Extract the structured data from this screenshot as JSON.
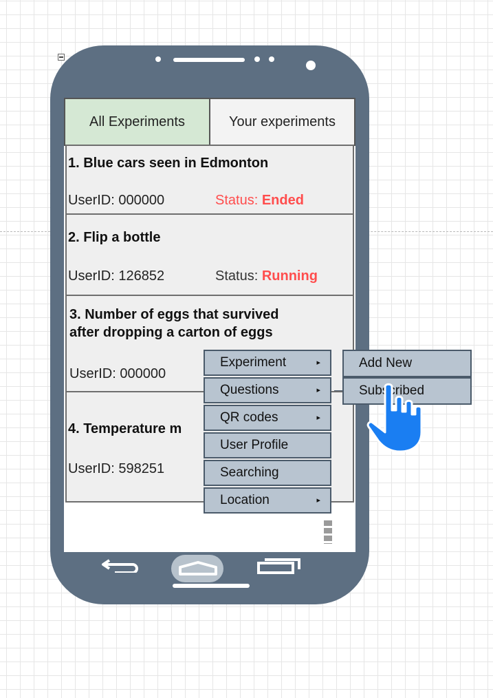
{
  "tabs": {
    "all_experiments": "All Experiments",
    "your_experiments": "Your experiments"
  },
  "experiments": [
    {
      "title": "1. Blue cars seen in Edmonton",
      "user_id": "UserID: 000000",
      "status_label": "Status:",
      "status_value": "Ended"
    },
    {
      "title": "2. Flip a bottle",
      "user_id": "UserID: 126852",
      "status_label": "Status:",
      "status_value": "Running"
    },
    {
      "title_line1": "3. Number of eggs that survived",
      "title_line2": "after dropping a carton of eggs",
      "user_id": "UserID: 000000"
    },
    {
      "title": "4. Temperature m",
      "user_id": "UserID: 598251"
    }
  ],
  "menu": {
    "items": [
      {
        "label": "Experiment",
        "has_submenu": true
      },
      {
        "label": "Questions",
        "has_submenu": true
      },
      {
        "label": "QR codes",
        "has_submenu": true
      },
      {
        "label": "User Profile",
        "has_submenu": false
      },
      {
        "label": "Searching",
        "has_submenu": false
      },
      {
        "label": "Location",
        "has_submenu": true
      }
    ],
    "submenu_arrow": "▸"
  },
  "submenu": {
    "items": [
      {
        "label": "Add New"
      },
      {
        "label": "Subscribed"
      }
    ]
  },
  "colors": {
    "phone_body": "#5d6f82",
    "active_tab": "#d5e8d4",
    "status_red": "#ff4d4d",
    "menu_bg": "#b8c4d0",
    "cursor_blue": "#1a7ef2"
  },
  "icons": [
    "back-icon",
    "home-icon",
    "recent-apps-icon",
    "hand-pointer-icon",
    "collapse-icon"
  ]
}
